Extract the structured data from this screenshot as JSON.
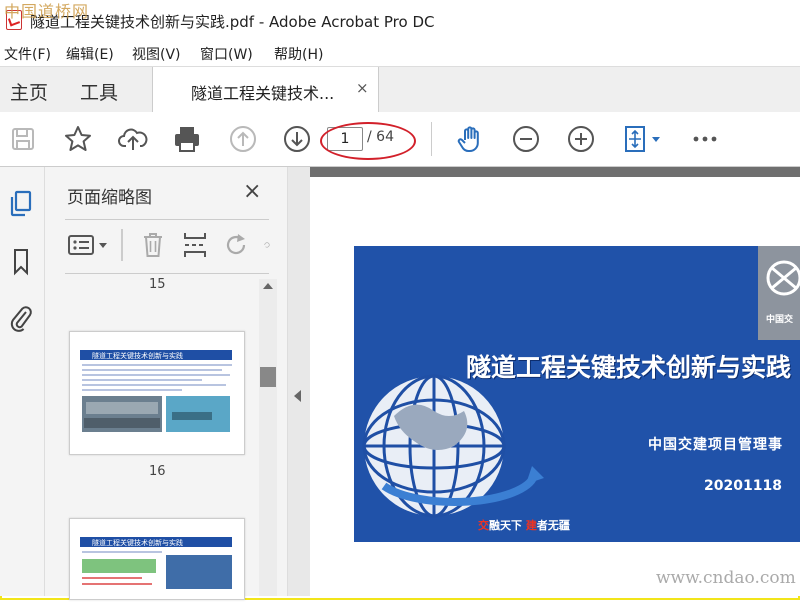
{
  "window": {
    "title": "隧道工程关键技术创新与实践.pdf - Adobe Acrobat Pro DC",
    "watermark_top_left": "中国道桥网",
    "watermark_bottom_right": "www.cndao.com"
  },
  "menu": [
    "文件(F)",
    "编辑(E)",
    "视图(V)",
    "窗口(W)",
    "帮助(H)"
  ],
  "tabs": {
    "home": "主页",
    "tools": "工具",
    "document": "隧道工程关键技术...",
    "close": "×"
  },
  "toolbar": {
    "page_current": "1",
    "page_total": "/ 64",
    "icons": [
      "save-icon",
      "star-icon",
      "upload-cloud-icon",
      "print-icon",
      "page-up-icon",
      "page-down-icon",
      "hand-icon",
      "zoom-out-icon",
      "zoom-in-icon",
      "fit-page-icon",
      "more-icon"
    ]
  },
  "thumbnails": {
    "title": "页面缩略图",
    "close": "×",
    "page_labels": [
      "15",
      "16"
    ],
    "thumb_headers": [
      "隧道工程关键技术创新与实践",
      "隧道工程关键技术创新与实践"
    ]
  },
  "slide": {
    "title": "隧道工程关键技术创新与实践",
    "org": "中国交建项目管理事",
    "date": "20201118",
    "slogan_red_1": "交",
    "slogan_1": "融天下  ",
    "slogan_red_2": "建",
    "slogan_2": "者无疆",
    "logo_text": "中国交"
  },
  "colors": {
    "accent_blue": "#2a6ebb",
    "slide_blue": "#1f4fa5",
    "annotation_red": "#d2202a"
  }
}
